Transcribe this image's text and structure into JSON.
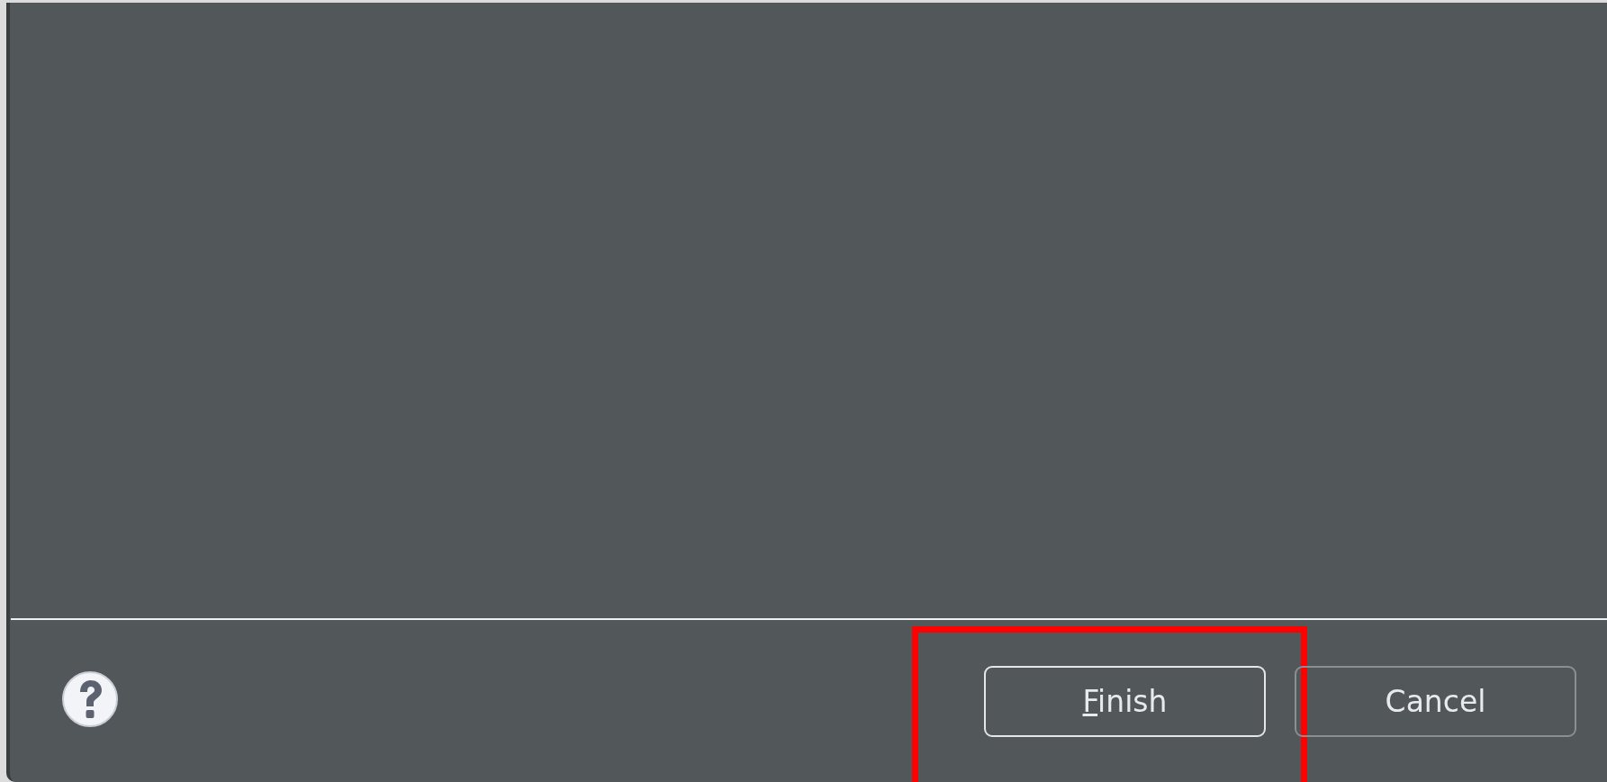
{
  "buttons": [
    {
      "label": "Finish",
      "mnemonic": true,
      "default": true,
      "highlighted": true
    },
    {
      "label": "Cancel",
      "mnemonic": false,
      "default": false,
      "highlighted": false
    }
  ]
}
